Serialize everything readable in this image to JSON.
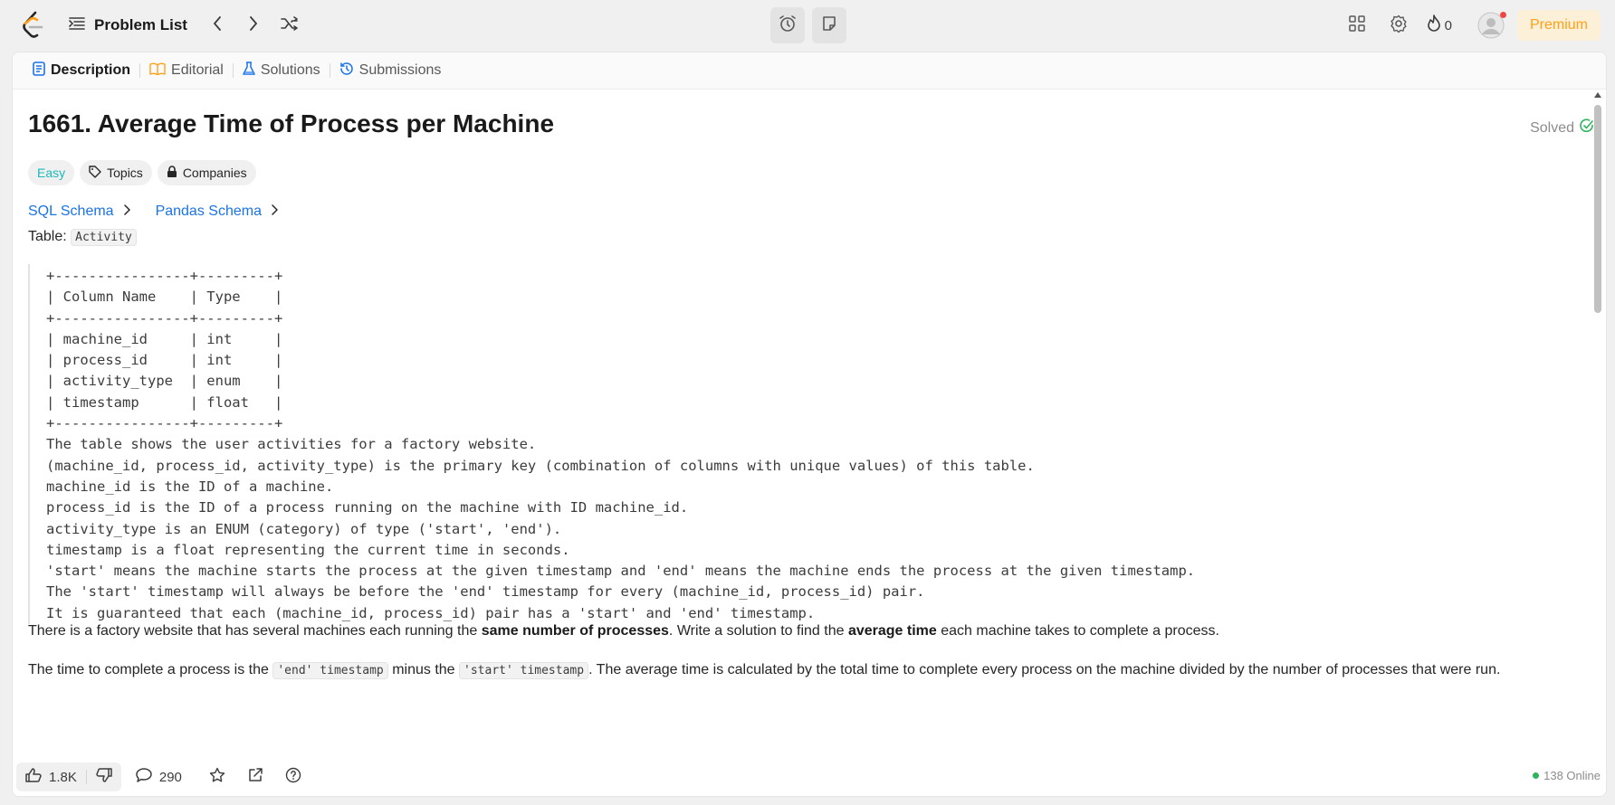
{
  "nav": {
    "problem_list_label": "Problem List",
    "streak_count": "0",
    "premium_label": "Premium",
    "icons": [
      "leetcode-logo",
      "list-icon",
      "chevron-left-icon",
      "chevron-right-icon",
      "shuffle-icon",
      "alarm-icon",
      "notes-icon",
      "layout-icon",
      "gear-icon",
      "fire-icon",
      "avatar-icon"
    ],
    "colors": {
      "premium_text": "#ffa116",
      "premium_bg": "#fdf0d9",
      "notification_dot": "#ef4743"
    }
  },
  "tabs": [
    {
      "label": "Description",
      "active": true,
      "icon": "document-icon"
    },
    {
      "label": "Editorial",
      "active": false,
      "icon": "book-icon"
    },
    {
      "label": "Solutions",
      "active": false,
      "icon": "flask-icon"
    },
    {
      "label": "Submissions",
      "active": false,
      "icon": "history-icon"
    }
  ],
  "problem": {
    "title": "1661. Average Time of Process per Machine",
    "status": "Solved",
    "difficulty": "Easy",
    "topics_label": "Topics",
    "companies_label": "Companies",
    "sql_schema_label": "SQL Schema",
    "pandas_schema_label": "Pandas Schema",
    "table_prefix": "Table:",
    "table_name": "Activity",
    "schema_block": "+----------------+---------+\n| Column Name    | Type    |\n+----------------+---------+\n| machine_id     | int     |\n| process_id     | int     |\n| activity_type  | enum    |\n| timestamp      | float   |\n+----------------+---------+\nThe table shows the user activities for a factory website.\n(machine_id, process_id, activity_type) is the primary key (combination of columns with unique values) of this table.\nmachine_id is the ID of a machine.\nprocess_id is the ID of a process running on the machine with ID machine_id.\nactivity_type is an ENUM (category) of type ('start', 'end').\ntimestamp is a float representing the current time in seconds.\n'start' means the machine starts the process at the given timestamp and 'end' means the machine ends the process at the given timestamp.\nThe 'start' timestamp will always be before the 'end' timestamp for every (machine_id, process_id) pair.\nIt is guaranteed that each (machine_id, process_id) pair has a 'start' and 'end' timestamp.",
    "para1": {
      "t1": "There is a factory website that has several machines each running the ",
      "b1": "same number of processes",
      "t2": ". Write a solution to find the ",
      "b2": "average time",
      "t3": " each machine takes to complete a process."
    },
    "para2": {
      "t1": "The time to complete a process is the ",
      "c1": "'end' timestamp",
      "t2": " minus the ",
      "c2": "'start' timestamp",
      "t3": ". The average time is calculated by the total time to complete every process on the machine divided by the number of processes that were run."
    },
    "colors": {
      "easy": "#1cb8b8",
      "link": "#1a73e8",
      "solved_check": "#2db55d"
    }
  },
  "footer": {
    "likes": "1.8K",
    "comments": "290",
    "online": "138 Online"
  }
}
